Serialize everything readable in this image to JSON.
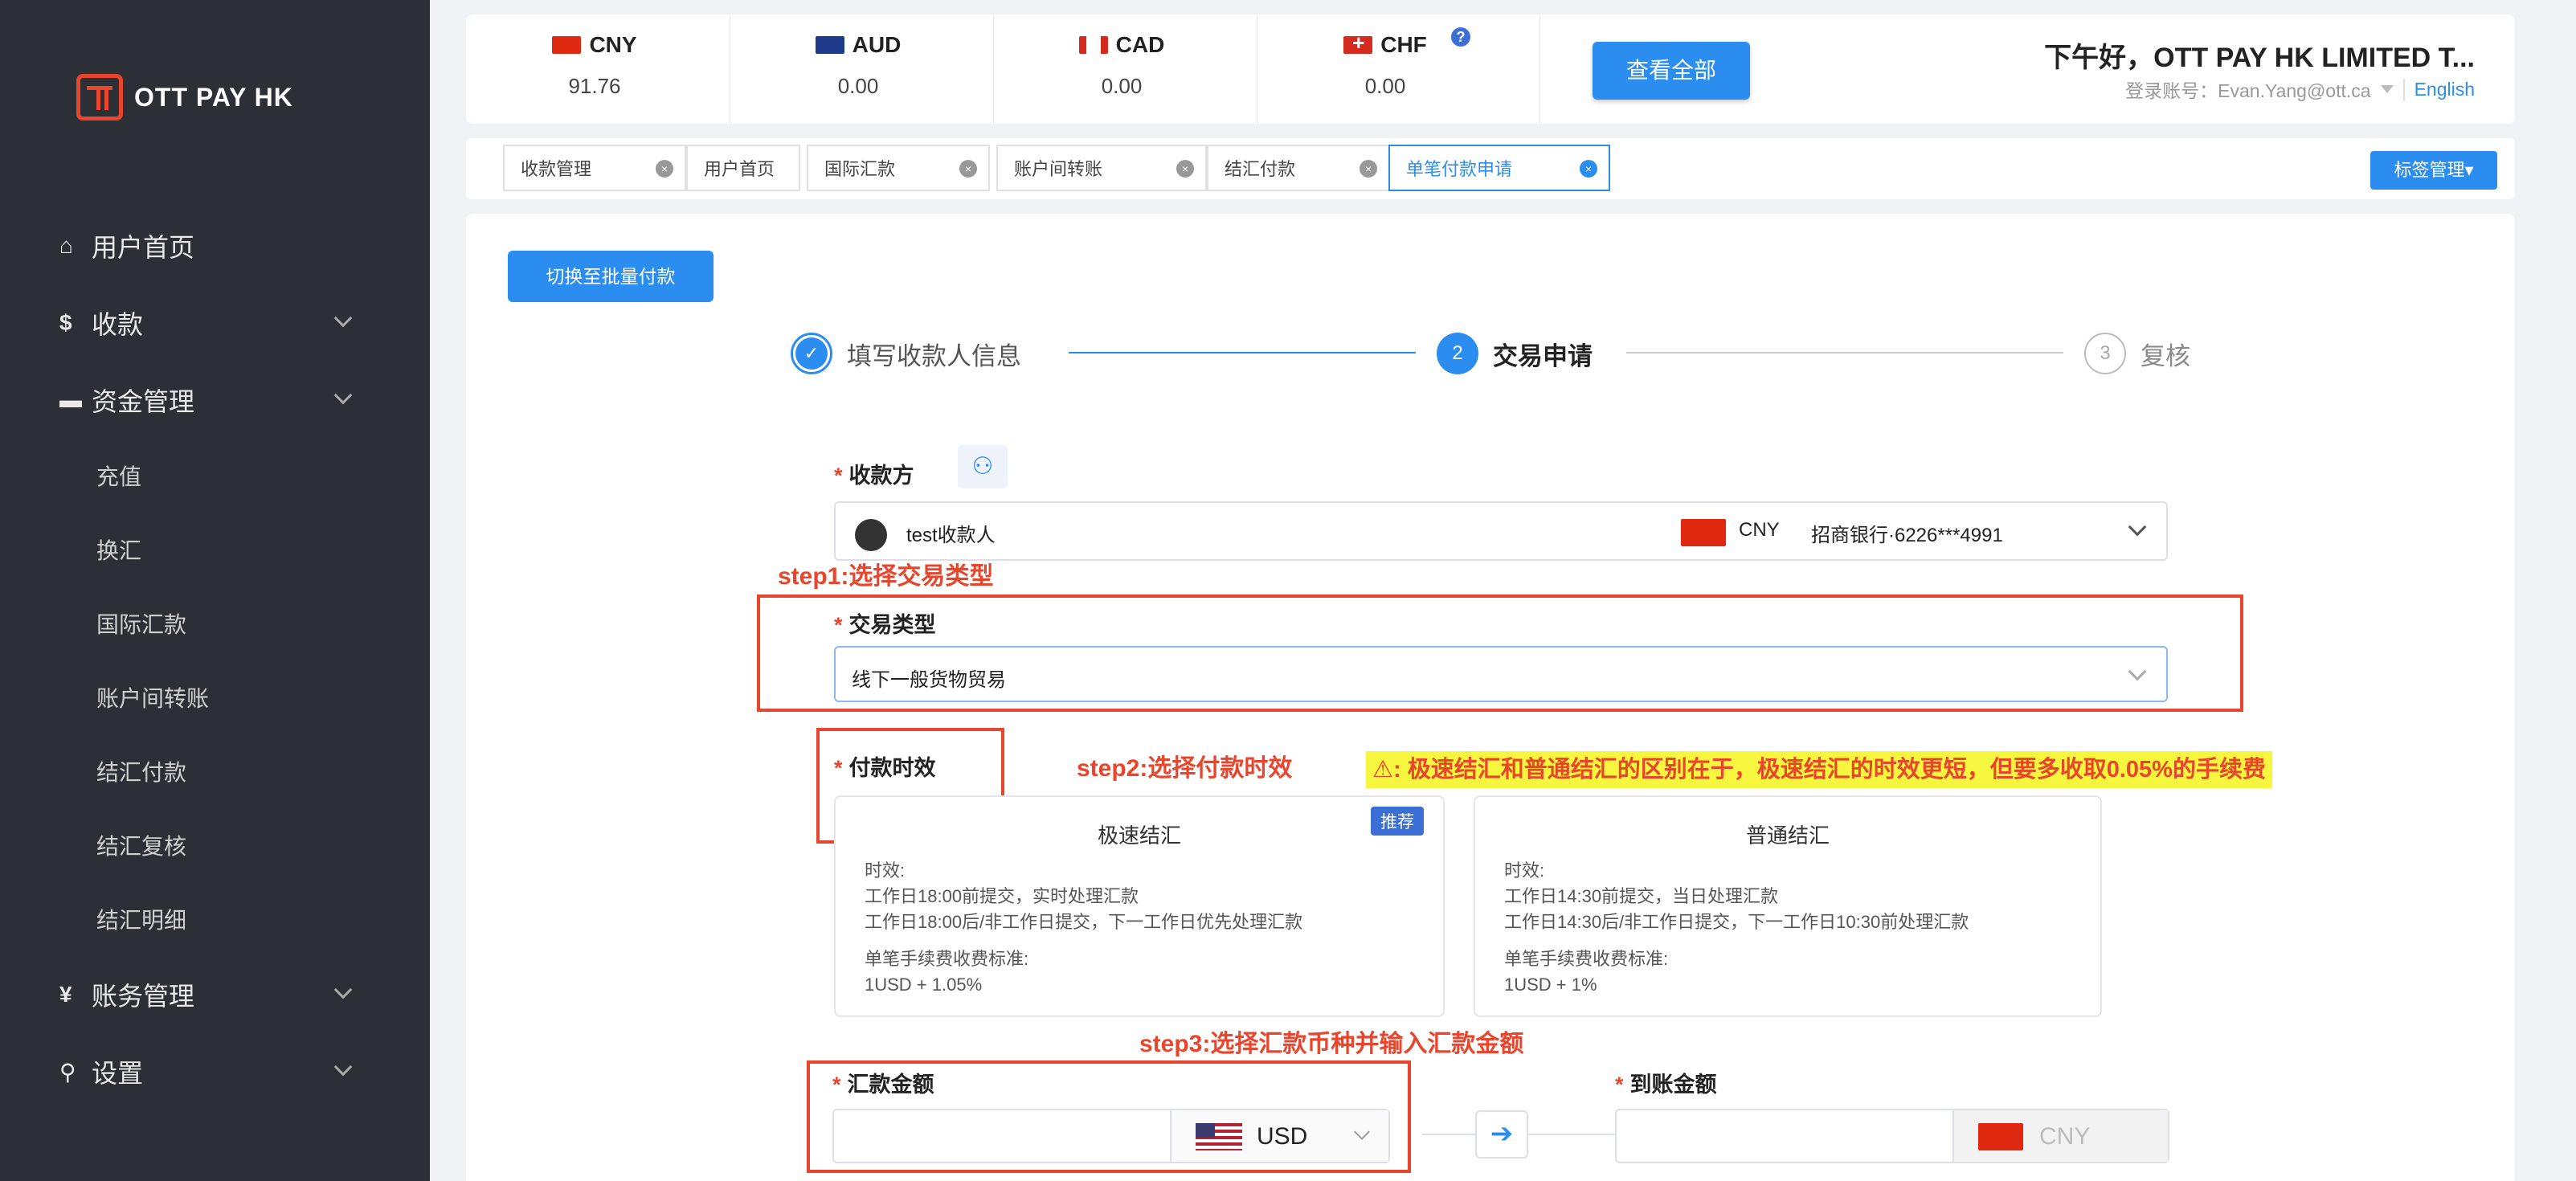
{
  "brand": {
    "name": "OTT PAY HK"
  },
  "sidebar": {
    "items": [
      {
        "label": "用户首页",
        "icon": "home-icon",
        "glyph": "⌂"
      },
      {
        "label": "收款",
        "icon": "dollar-icon",
        "glyph": "$"
      },
      {
        "label": "资金管理",
        "icon": "card-icon",
        "glyph": "▬"
      },
      {
        "label": "充值"
      },
      {
        "label": "换汇"
      },
      {
        "label": "国际汇款"
      },
      {
        "label": "账户间转账"
      },
      {
        "label": "结汇付款"
      },
      {
        "label": "结汇复核"
      },
      {
        "label": "结汇明细"
      },
      {
        "label": "账务管理",
        "icon": "yen-icon",
        "glyph": "¥"
      },
      {
        "label": "设置",
        "icon": "search-icon",
        "glyph": "⚲"
      }
    ]
  },
  "balances": [
    {
      "code": "CNY",
      "value": "91.76"
    },
    {
      "code": "AUD",
      "value": "0.00"
    },
    {
      "code": "CAD",
      "value": "0.00"
    },
    {
      "code": "CHF",
      "value": "0.00"
    }
  ],
  "header": {
    "help": "?",
    "view_all": "查看全部",
    "greeting": "下午好，OTT PAY HK LIMITED T...",
    "account": "登录账号：Evan.Yang@ott.ca",
    "language": "English"
  },
  "tabs": [
    {
      "label": "收款管理"
    },
    {
      "label": "用户首页"
    },
    {
      "label": "国际汇款"
    },
    {
      "label": "账户间转账"
    },
    {
      "label": "结汇付款"
    },
    {
      "label": "单笔付款申请"
    }
  ],
  "tag_manage": "标签管理▾",
  "form": {
    "batch_switch": "切换至批量付款",
    "steps": [
      {
        "num": "✓",
        "label": "填写收款人信息"
      },
      {
        "num": "2",
        "label": "交易申请"
      },
      {
        "num": "3",
        "label": "复核"
      }
    ],
    "payee_label": "收款方",
    "payee_name": "test收款人",
    "payee_currency": "CNY",
    "payee_bank": "招商银行·6226***4991",
    "trade_type_label": "交易类型",
    "trade_type_value": "线下一般货物贸易",
    "timing_label": "付款时效",
    "options": [
      {
        "title": "极速结汇",
        "badge": "推荐",
        "l1": "时效:",
        "l2": "工作日18:00前提交，实时处理汇款",
        "l3": "工作日18:00后/非工作日提交，下一工作日优先处理汇款",
        "l4": "单笔手续费收费标准:",
        "l5": "1USD + 1.05%"
      },
      {
        "title": "普通结汇",
        "l1": "时效:",
        "l2": "工作日14:30前提交，当日处理汇款",
        "l3": "工作日14:30后/非工作日提交，下一工作日10:30前处理汇款",
        "l4": "单笔手续费收费标准:",
        "l5": "1USD + 1%"
      }
    ],
    "amount_label": "汇款金额",
    "amount_currency": "USD",
    "receive_label": "到账金额",
    "receive_currency": "CNY",
    "convert_arrow": "➔"
  },
  "annotations": {
    "step1": "step1:选择交易类型",
    "step2": "step2:选择付款时效",
    "step3": "step3:选择汇款币种并输入汇款金额",
    "warning": "⚠: 极速结汇和普通结汇的区别在于，极速结汇的时效更短，但要多收取0.05%的手续费"
  },
  "colors": {
    "accent": "#2b8df0",
    "annotation": "#e8452c",
    "sidebar": "#2d2f36",
    "highlight": "#f6f63f"
  }
}
